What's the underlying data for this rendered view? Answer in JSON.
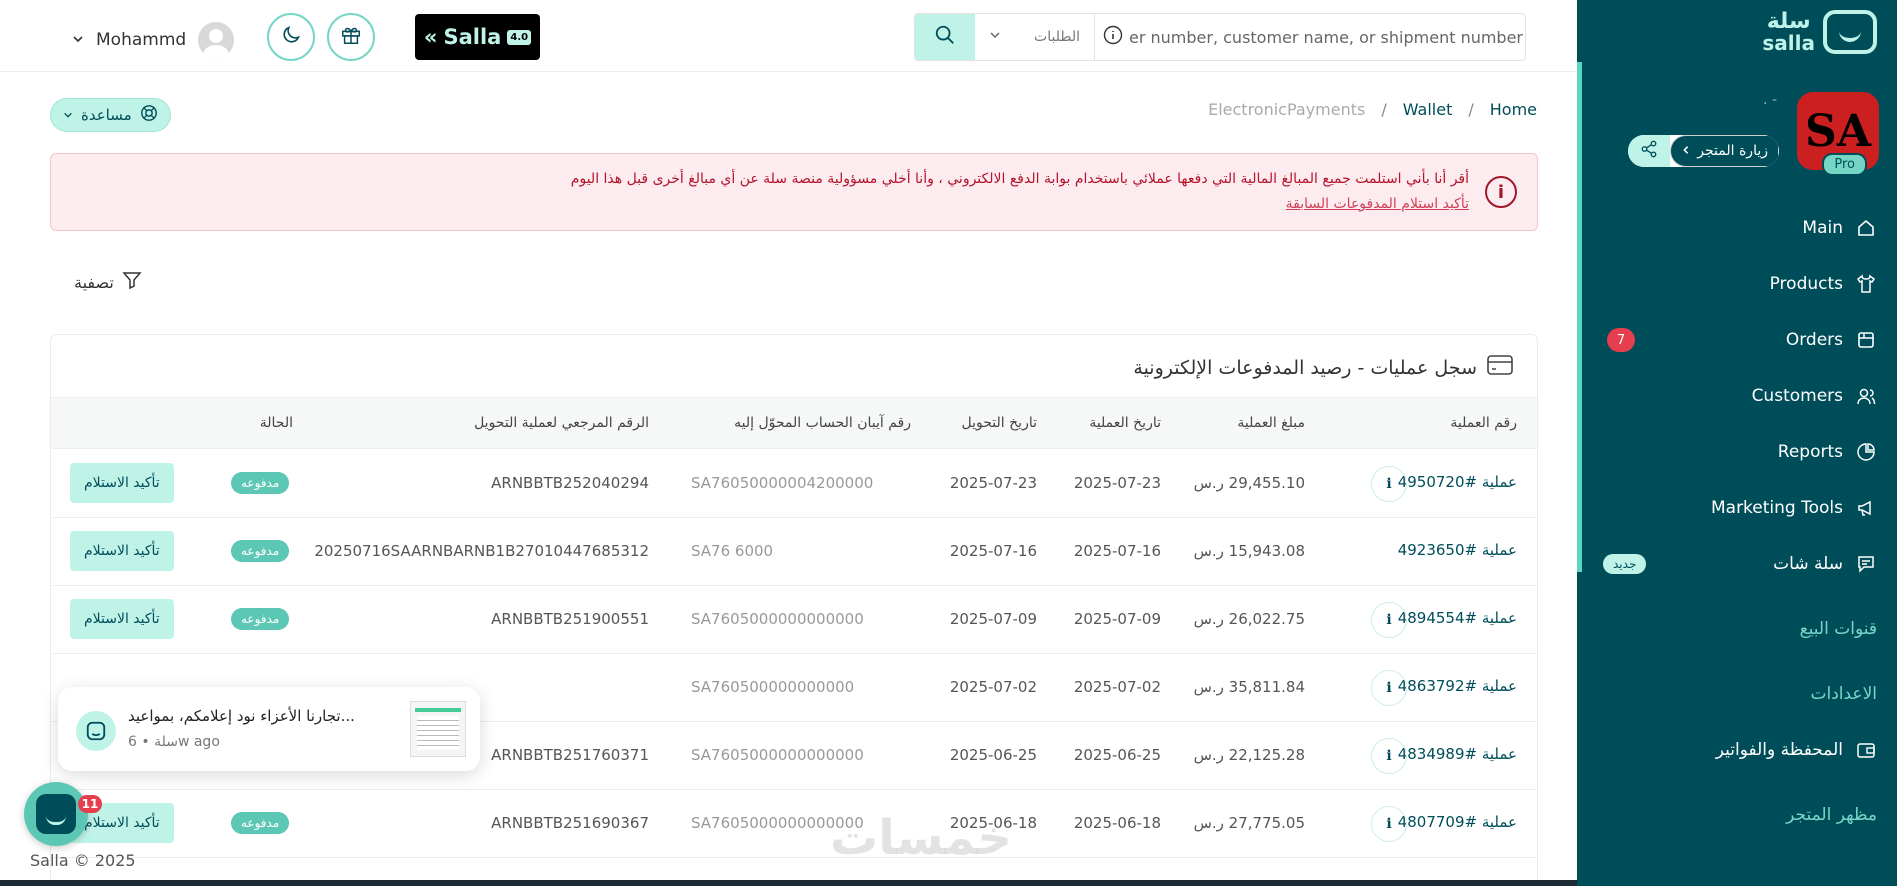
{
  "topbar": {
    "user_name": "Mohammd",
    "salla_btn_label": "Salla",
    "salla_version": "4.0",
    "search_scope": "الطلبات",
    "search_placeholder": "er number, customer name, or shipment number"
  },
  "sidebar": {
    "logo_ar": "سلة",
    "logo_en": "salla",
    "store_avatar_text": "SA",
    "pro_label": "Pro",
    "dots": "- .",
    "visit_store_label": "زيارة المتجر",
    "items": [
      {
        "label": "Main",
        "icon": "home-icon"
      },
      {
        "label": "Products",
        "icon": "shirt-icon"
      },
      {
        "label": "Orders",
        "icon": "orders-icon",
        "badge": "7"
      },
      {
        "label": "Customers",
        "icon": "users-icon"
      },
      {
        "label": "Reports",
        "icon": "pie-chart-icon"
      },
      {
        "label": "Marketing Tools",
        "icon": "megaphone-icon"
      },
      {
        "label": "سلة شات",
        "icon": "chat-icon",
        "tag": "جديد"
      }
    ],
    "sections": [
      "قنوات البيع",
      "الاعدادات"
    ],
    "wallet_item": "المحفظة والفواتير",
    "store_look": "مظهر المتجر"
  },
  "content": {
    "help_label": "مساعدة",
    "breadcrumb": [
      "Home",
      "Wallet",
      "ElectronicPayments"
    ],
    "breadcrumb_sep": "/",
    "alert_message": "أقر أنا بأني استلمت جميع المبالغ المالية التي دفعها عملائي باستخدام بوابة الدفع الالكتروني ، وأنا أخلي مسؤولية منصة سلة عن أي مبالغ أخرى قبل هذا اليوم",
    "alert_link": "تأكيد استلام المدفوعات السابقة",
    "filter_label": "تصفية",
    "card_title": "سجل عمليات - رصيد المدفوعات الإلكترونية",
    "columns": {
      "op_number": "رقم العملية",
      "amount": "مبلغ العملية",
      "op_date": "تاريخ العملية",
      "transfer_date": "تاريخ التحويل",
      "iban": "رقم آيبان الحساب المحوّل إليه",
      "reference": "الرقم المرجعي لعملية التحويل",
      "status": "الحالة"
    },
    "rows": [
      {
        "op": "عملية #4950720",
        "amount": "29,455.10 ر.س",
        "op_date": "2025-07-23",
        "transfer_date": "2025-07-23",
        "iban": "SA76050000004200000",
        "reference": "ARNBBTB252040294",
        "status": "مدفوعه",
        "action": "تأكيد الاستلام",
        "info": true
      },
      {
        "op": "عملية #4923650",
        "amount": "15,943.08 ر.س",
        "op_date": "2025-07-16",
        "transfer_date": "2025-07-16",
        "iban": "SA76          ‍6000",
        "reference": "20250716SAARNBARNB1B27010447685312",
        "status": "مدفوعه",
        "action": "تأكيد الاستلام",
        "info": false
      },
      {
        "op": "عملية #4894554",
        "amount": "26,022.75 ر.س",
        "op_date": "2025-07-09",
        "transfer_date": "2025-07-09",
        "iban": "SA7605000000000000",
        "reference": "ARNBBTB251900551",
        "status": "مدفوعه",
        "action": "تأكيد الاستلام",
        "info": true
      },
      {
        "op": "عملية #4863792",
        "amount": "35,811.84 ر.س",
        "op_date": "2025-07-02",
        "transfer_date": "2025-07-02",
        "iban": "SA760500000000000",
        "reference": "",
        "status": "",
        "action": "",
        "info": true
      },
      {
        "op": "عملية #4834989",
        "amount": "22,125.28 ر.س",
        "op_date": "2025-06-25",
        "transfer_date": "2025-06-25",
        "iban": "SA7605000000000000",
        "reference": "ARNBBTB251760371",
        "status": "",
        "action": "",
        "info": true
      },
      {
        "op": "عملية #4807709",
        "amount": "27,775.05 ر.س",
        "op_date": "2025-06-18",
        "transfer_date": "2025-06-18",
        "iban": "SA7605000000000000",
        "reference": "ARNBBTB251690367",
        "status": "مدفوعه",
        "action": "تأكيد الاستلام",
        "info": true
      }
    ]
  },
  "popup": {
    "message": "...تجارنا الأعزاء  نود إعلامكم، بمواعيد",
    "meta": "6 • سلةw ago"
  },
  "chat_badge": "11",
  "footer": "Salla © 2025",
  "watermark": "خمسات",
  "colors": {
    "sidebar_bg": "#004d5a",
    "accent": "#bff3e8",
    "status": "#5cc7b4",
    "alert_bg": "#fdecef",
    "badge": "#e53e4f"
  }
}
